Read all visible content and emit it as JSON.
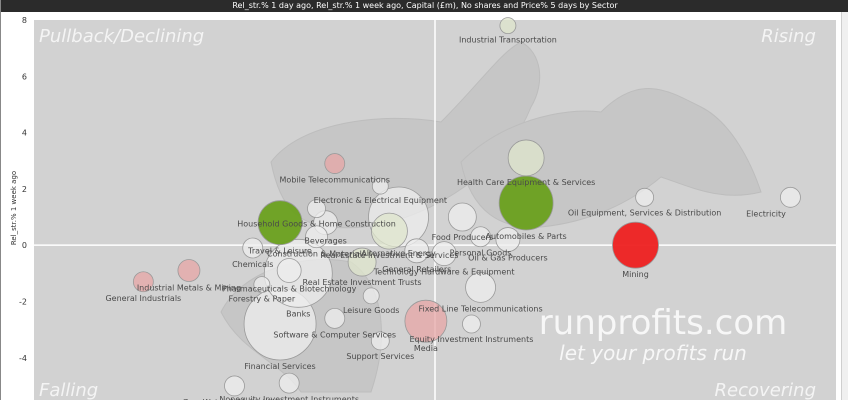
{
  "window": {
    "title": "Rel_str.% 1 day ago, Rel_str.% 1 week ago, Capital (£m), No shares and Price% 5 days by Sector"
  },
  "chart_data": {
    "type": "scatter",
    "title": "",
    "xlabel": "",
    "ylabel": "Rel_str.% 1 week ago",
    "ylim": [
      -5.5,
      8
    ],
    "xlim": [
      -4.4,
      4.4
    ],
    "yticks": [
      -4,
      -2,
      0,
      2,
      4,
      6,
      8
    ],
    "grid": false,
    "quadrants": {
      "top_left": "Pullback/Declining",
      "top_right": "Rising",
      "bottom_left": "Falling",
      "bottom_right": "Recovering"
    },
    "watermark": {
      "line1": "runprofits.com",
      "line2": "let your profits run"
    },
    "colors": {
      "plot_bg": "#d2d2d2",
      "bubble_grey": "#eeeeee",
      "bubble_lightgreen": "#dfe6cc",
      "bubble_green": "#6aa01e",
      "bubble_pink": "#e7a6a6",
      "bubble_red": "#ee2020",
      "label": "#4a4a4a",
      "quadrant_text": "#f4f4f4"
    },
    "points": [
      {
        "name": "Industrial Transportation",
        "x": 0.8,
        "y": 7.8,
        "size": 8,
        "color": "bubble_lightgreen"
      },
      {
        "name": "Mobile Telecommunications",
        "x": -1.1,
        "y": 2.9,
        "size": 10,
        "color": "bubble_pink"
      },
      {
        "name": "Electronic & Electrical Equipment",
        "x": -0.6,
        "y": 2.1,
        "size": 8,
        "color": "bubble_grey"
      },
      {
        "name": "Household Goods & Home Construction",
        "x": -1.3,
        "y": 1.3,
        "size": 9,
        "color": "bubble_grey"
      },
      {
        "name": "Alternative Energy",
        "x": -0.4,
        "y": 1.0,
        "size": 30,
        "color": "bubble_grey"
      },
      {
        "name": "Beverages",
        "x": -1.2,
        "y": 0.8,
        "size": 12,
        "color": "bubble_grey"
      },
      {
        "name": "Travel & Leisure",
        "x": -1.7,
        "y": 0.8,
        "size": 22,
        "color": "bubble_green"
      },
      {
        "name": "Construction & Materials",
        "x": -1.3,
        "y": 0.3,
        "size": 11,
        "color": "bubble_grey"
      },
      {
        "name": "Real Estate Investment & Services",
        "x": -0.5,
        "y": 0.5,
        "size": 18,
        "color": "bubble_lightgreen"
      },
      {
        "name": "Chemicals",
        "x": -2.0,
        "y": -0.1,
        "size": 10,
        "color": "bubble_grey"
      },
      {
        "name": "General Retailers",
        "x": -0.2,
        "y": -0.2,
        "size": 12,
        "color": "bubble_grey"
      },
      {
        "name": "Banks",
        "x": -1.5,
        "y": -1.0,
        "size": 34,
        "color": "bubble_grey"
      },
      {
        "name": "Real Estate Investment Trusts",
        "x": -0.8,
        "y": -0.6,
        "size": 14,
        "color": "bubble_lightgreen"
      },
      {
        "name": "Leisure Goods",
        "x": -0.7,
        "y": -1.8,
        "size": 8,
        "color": "bubble_grey"
      },
      {
        "name": "Pharmaceuticals & Biotechnology",
        "x": -1.6,
        "y": -0.9,
        "size": 12,
        "color": "bubble_grey"
      },
      {
        "name": "Forestry & Paper",
        "x": -1.9,
        "y": -1.4,
        "size": 8,
        "color": "bubble_grey"
      },
      {
        "name": "Industrial Metals & Mining",
        "x": -2.7,
        "y": -0.9,
        "size": 11,
        "color": "bubble_pink"
      },
      {
        "name": "General Industrials",
        "x": -3.2,
        "y": -1.3,
        "size": 10,
        "color": "bubble_pink"
      },
      {
        "name": "Software & Computer Services",
        "x": -1.1,
        "y": -2.6,
        "size": 10,
        "color": "bubble_grey"
      },
      {
        "name": "Support Services",
        "x": -0.6,
        "y": -3.4,
        "size": 9,
        "color": "bubble_grey"
      },
      {
        "name": "Financial Services",
        "x": -1.7,
        "y": -2.8,
        "size": 36,
        "color": "bubble_grey"
      },
      {
        "name": "Equity Investment Instruments",
        "x": 0.4,
        "y": -2.8,
        "size": 9,
        "color": "bubble_grey"
      },
      {
        "name": "Media",
        "x": -0.1,
        "y": -2.7,
        "size": 21,
        "color": "bubble_pink"
      },
      {
        "name": "Nonequity Investment Instruments",
        "x": -1.6,
        "y": -4.9,
        "size": 10,
        "color": "bubble_grey"
      },
      {
        "name": "Gas, Water & Multiutilities",
        "x": -2.2,
        "y": -5.0,
        "size": 10,
        "color": "bubble_grey"
      },
      {
        "name": "Health Care Equipment & Services",
        "x": 1.0,
        "y": 3.1,
        "size": 18,
        "color": "bubble_lightgreen"
      },
      {
        "name": "Food Producers",
        "x": 0.3,
        "y": 1.0,
        "size": 14,
        "color": "bubble_grey"
      },
      {
        "name": "Automobiles & Parts",
        "x": 1.0,
        "y": 1.5,
        "size": 27,
        "color": "bubble_green"
      },
      {
        "name": "Personal Goods",
        "x": 0.5,
        "y": 0.3,
        "size": 10,
        "color": "bubble_grey"
      },
      {
        "name": "Oil & Gas Producers",
        "x": 0.8,
        "y": 0.2,
        "size": 12,
        "color": "bubble_grey"
      },
      {
        "name": "Technology Hardware & Equipment",
        "x": 0.1,
        "y": -0.3,
        "size": 12,
        "color": "bubble_grey"
      },
      {
        "name": "Fixed Line Telecommunications",
        "x": 0.5,
        "y": -1.5,
        "size": 15,
        "color": "bubble_grey"
      },
      {
        "name": "Oil Equipment, Services & Distribution",
        "x": 2.3,
        "y": 1.7,
        "size": 9,
        "color": "bubble_grey"
      },
      {
        "name": "Electricity",
        "x": 3.9,
        "y": 1.7,
        "size": 10,
        "color": "bubble_grey"
      },
      {
        "name": "Mining",
        "x": 2.2,
        "y": 0.0,
        "size": 23,
        "color": "bubble_red"
      }
    ]
  }
}
